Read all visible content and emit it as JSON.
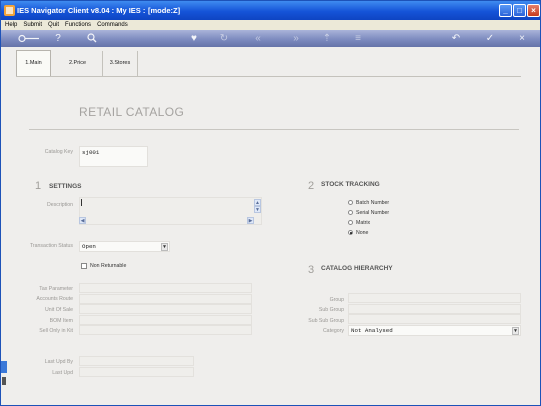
{
  "window": {
    "title": "IES Navigator Client v8.04 : My IES :",
    "mode": "[mode:Z]"
  },
  "menu": [
    "Help",
    "Submit",
    "Quit",
    "Functions",
    "Commands"
  ],
  "tabs": [
    {
      "label": "1.Main"
    },
    {
      "label": "2.Price"
    },
    {
      "label": "3.Stores"
    }
  ],
  "page_title": "RETAIL CATALOG",
  "catalog_key": {
    "label": "Catalog Key",
    "value": "sj001"
  },
  "settings": {
    "number": "1",
    "title": "SETTINGS",
    "description_label": "Description",
    "description_value": "",
    "transaction_status_label": "Transaction Status",
    "transaction_status_value": "Open",
    "non_returnable_label": "Non Returnable",
    "non_returnable_checked": false
  },
  "stock_tracking": {
    "number": "2",
    "title": "STOCK TRACKING",
    "options": [
      "Batch Number",
      "Serial Number",
      "Matrix",
      "None"
    ],
    "selected": "None"
  },
  "details": {
    "tax_parameter_label": "Tax Parameter",
    "accounts_route_label": "Accounts Route",
    "unit_of_sale_label": "Unit Of Sale",
    "bom_item_label": "BOM Item",
    "sell_only_in_kit_label": "Sell Only in Kit"
  },
  "catalog_hierarchy": {
    "number": "3",
    "title": "CATALOG HIERARCHY",
    "group_label": "Group",
    "sub_group_label": "Sub Group",
    "sub_sub_group_label": "Sub Sub Group",
    "category_label": "Category",
    "category_value": "Not Analysed"
  },
  "audit": {
    "last_upd_by_label": "Last Upd By",
    "last_upd_label": "Last Upd"
  }
}
